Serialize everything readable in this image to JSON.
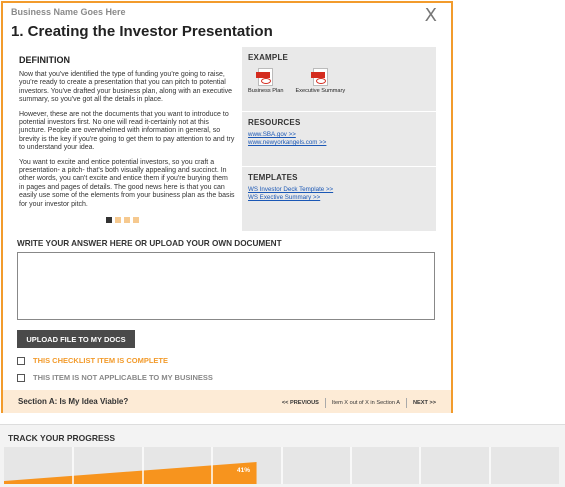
{
  "modal": {
    "business_name": "Business Name Goes Here",
    "close_glyph": "X",
    "title": "1. Creating the Investor Presentation"
  },
  "definition": {
    "heading": "DEFINITION",
    "paragraphs": [
      "Now that you've identified the type of funding you're going to raise, you're ready to create a presentation that you can pitch to potential investors. You've drafted your business plan, along with an executive summary, so you've got all the details in place.",
      "However, these are not the documents that you want to introduce to potential investors first. No one will read it-certainly not at this juncture. People are overwhelmed with information in general, so brevity is the key if you're going to get them to pay attention to and try to understand your idea.",
      "You want to excite and entice potential investors, so you craft a presentation- a pitch- that's both visually appealing and succinct. In other words, you can't excite and entice them if you're burying them in pages and pages of details. The good news here is that you can easily use some of the elements from your business plan as the basis for your investor pitch."
    ],
    "pager_total": 4,
    "pager_active": 1
  },
  "example": {
    "heading": "EXAMPLE",
    "docs": [
      {
        "label": "Business Plan",
        "icon": "pdf-icon"
      },
      {
        "label": "Executive Summary",
        "icon": "pdf-icon"
      }
    ]
  },
  "resources": {
    "heading": "RESOURCES",
    "links": [
      "www.SBA.gov >>",
      "www.newyorkangels.com >>"
    ]
  },
  "templates": {
    "heading": "TEMPLATES",
    "links": [
      "WS Investor Deck Template >>",
      "WS Exective Summary >>"
    ]
  },
  "answer": {
    "heading": "WRITE YOUR ANSWER HERE OR UPLOAD YOUR OWN DOCUMENT",
    "value": "",
    "upload_label": "UPLOAD FILE TO MY DOCS",
    "checklist_complete": "THIS CHECKLIST ITEM IS COMPLETE",
    "not_applicable": "THIS ITEM IS NOT APPLICABLE TO MY BUSINESS"
  },
  "footer": {
    "section_label": "Section A: Is My Idea Viable?",
    "prev": "<< PREVIOUS",
    "position": "Item X out of X in Section A",
    "next": "NEXT >>"
  },
  "progress": {
    "title": "TRACK YOUR PROGRESS",
    "percent_label": "41%",
    "percent": 41,
    "segments": 8
  },
  "colors": {
    "accent": "#f29b2c",
    "progress_fill": "#f7941e",
    "link": "#1a57b5",
    "pdf_red": "#d42b1e"
  }
}
